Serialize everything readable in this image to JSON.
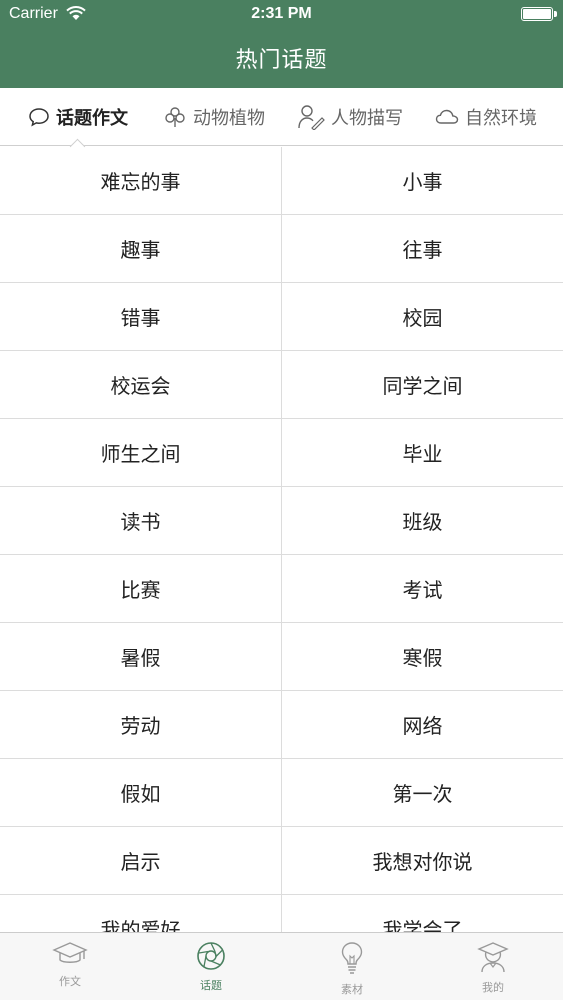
{
  "status": {
    "carrier": "Carrier",
    "time": "2:31 PM"
  },
  "header": {
    "title": "热门话题"
  },
  "categories": [
    {
      "label": "话题作文",
      "icon": "speech-bubble-icon",
      "active": true
    },
    {
      "label": "动物植物",
      "icon": "clover-icon",
      "active": false
    },
    {
      "label": "人物描写",
      "icon": "person-pen-icon",
      "active": false
    },
    {
      "label": "自然环境",
      "icon": "cloud-icon",
      "active": false
    }
  ],
  "topics": [
    [
      "难忘的事",
      "小事"
    ],
    [
      "趣事",
      "往事"
    ],
    [
      "错事",
      "校园"
    ],
    [
      "校运会",
      "同学之间"
    ],
    [
      "师生之间",
      "毕业"
    ],
    [
      "读书",
      "班级"
    ],
    [
      "比赛",
      "考试"
    ],
    [
      "暑假",
      "寒假"
    ],
    [
      "劳动",
      "网络"
    ],
    [
      "假如",
      "第一次"
    ],
    [
      "启示",
      "我想对你说"
    ],
    [
      "我的爱好",
      "我学会了"
    ]
  ],
  "tabs": [
    {
      "label": "作文",
      "icon": "graduation-cap-icon",
      "active": false
    },
    {
      "label": "话题",
      "icon": "aperture-icon",
      "active": true
    },
    {
      "label": "素材",
      "icon": "lightbulb-icon",
      "active": false
    },
    {
      "label": "我的",
      "icon": "graduate-avatar-icon",
      "active": false
    }
  ],
  "colors": {
    "header_bg": "#4a8060",
    "accent": "#4a8060",
    "tab_inactive": "#999999"
  }
}
